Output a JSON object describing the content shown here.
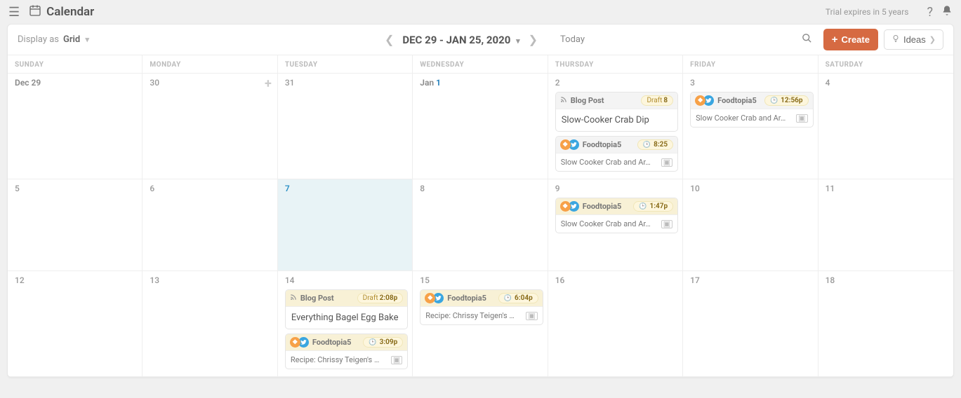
{
  "topbar": {
    "title": "Calendar",
    "trial_text": "Trial expires in 5 years"
  },
  "toolbar": {
    "display_as_label": "Display as",
    "display_as_value": "Grid",
    "date_range": "DEC 29 - JAN 25, 2020",
    "today": "Today",
    "create": "Create",
    "ideas": "Ideas"
  },
  "day_headers": [
    "SUNDAY",
    "MONDAY",
    "TUESDAY",
    "WEDNESDAY",
    "THURSDAY",
    "FRIDAY",
    "SATURDAY"
  ],
  "weeks": [
    {
      "cells": [
        {
          "label": "Dec 29",
          "events": [],
          "hover": false
        },
        {
          "label": "30",
          "events": [],
          "hover": true
        },
        {
          "label": "31",
          "events": []
        },
        {
          "label_html": "Jan <span class='one-blue'>1</span>",
          "events": []
        },
        {
          "label": "2",
          "events": [
            {
              "type": "blog",
              "head_label": "Blog Post",
              "pill": "Draft",
              "pill_bold": "8",
              "title": "Slow-Cooker Crab Dip"
            },
            {
              "type": "social",
              "account": "Foodtopia5",
              "time": "8:25",
              "body": "Slow Cooker Crab and Ar…",
              "has_img": true
            }
          ]
        },
        {
          "label": "3",
          "events": [
            {
              "type": "social",
              "account": "Foodtopia5",
              "time": "12:56p",
              "body": "Slow Cooker Crab and Ar…",
              "has_img": true
            }
          ]
        },
        {
          "label": "4",
          "events": []
        }
      ]
    },
    {
      "cells": [
        {
          "label": "5",
          "events": []
        },
        {
          "label": "6",
          "events": []
        },
        {
          "label": "7",
          "events": [],
          "highlight": true,
          "blue": true
        },
        {
          "label": "8",
          "events": []
        },
        {
          "label": "9",
          "events": [
            {
              "type": "social",
              "account": "Foodtopia5",
              "time": "1:47p",
              "body": "Slow Cooker Crab and Ar…",
              "has_img": true,
              "head_tan": true
            }
          ]
        },
        {
          "label": "10",
          "events": []
        },
        {
          "label": "11",
          "events": []
        }
      ]
    },
    {
      "cells": [
        {
          "label": "12",
          "events": []
        },
        {
          "label": "13",
          "events": []
        },
        {
          "label": "14",
          "events": [
            {
              "type": "blog",
              "head_label": "Blog Post",
              "pill": "Draft",
              "pill_bold": "2:08p",
              "title": "Everything Bagel Egg Bake",
              "head_tan": true
            },
            {
              "type": "social",
              "account": "Foodtopia5",
              "time": "3:09p",
              "body": "Recipe: Chrissy Teigen's …",
              "has_img": true,
              "head_tan": true
            }
          ]
        },
        {
          "label": "15",
          "events": [
            {
              "type": "social",
              "account": "Foodtopia5",
              "time": "6:04p",
              "body": "Recipe: Chrissy Teigen's …",
              "has_img": true,
              "head_tan": true
            }
          ]
        },
        {
          "label": "16",
          "events": []
        },
        {
          "label": "17",
          "events": []
        },
        {
          "label": "18",
          "events": []
        }
      ]
    }
  ]
}
